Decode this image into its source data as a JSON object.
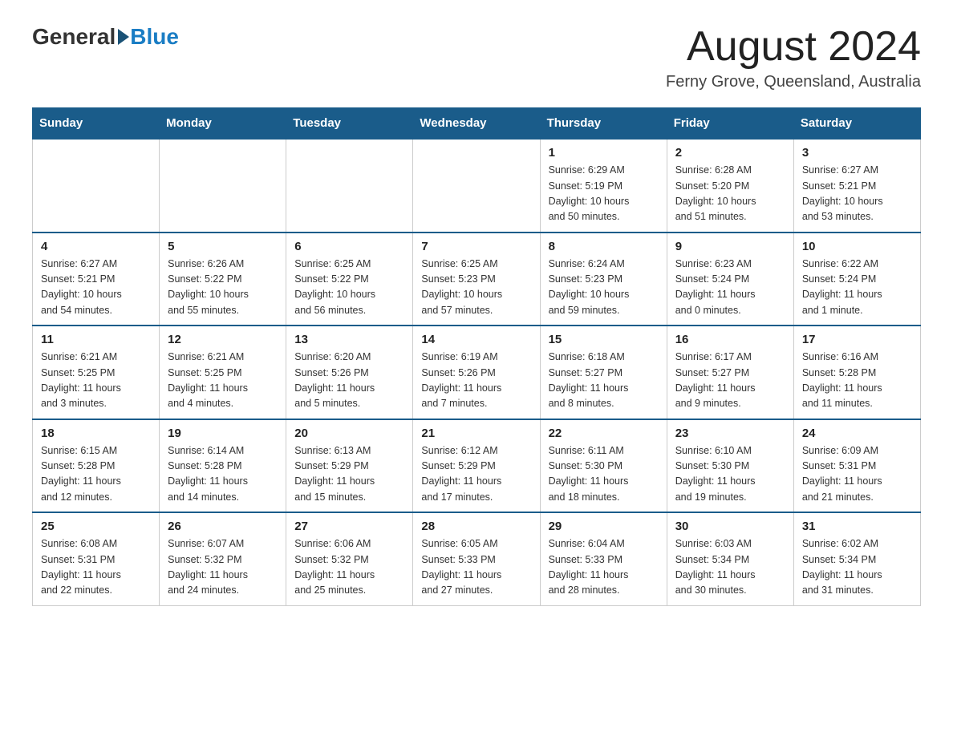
{
  "header": {
    "logo": {
      "general": "General",
      "blue": "Blue"
    },
    "title": "August 2024",
    "location": "Ferny Grove, Queensland, Australia"
  },
  "weekdays": [
    "Sunday",
    "Monday",
    "Tuesday",
    "Wednesday",
    "Thursday",
    "Friday",
    "Saturday"
  ],
  "weeks": [
    [
      {
        "day": "",
        "info": ""
      },
      {
        "day": "",
        "info": ""
      },
      {
        "day": "",
        "info": ""
      },
      {
        "day": "",
        "info": ""
      },
      {
        "day": "1",
        "info": "Sunrise: 6:29 AM\nSunset: 5:19 PM\nDaylight: 10 hours\nand 50 minutes."
      },
      {
        "day": "2",
        "info": "Sunrise: 6:28 AM\nSunset: 5:20 PM\nDaylight: 10 hours\nand 51 minutes."
      },
      {
        "day": "3",
        "info": "Sunrise: 6:27 AM\nSunset: 5:21 PM\nDaylight: 10 hours\nand 53 minutes."
      }
    ],
    [
      {
        "day": "4",
        "info": "Sunrise: 6:27 AM\nSunset: 5:21 PM\nDaylight: 10 hours\nand 54 minutes."
      },
      {
        "day": "5",
        "info": "Sunrise: 6:26 AM\nSunset: 5:22 PM\nDaylight: 10 hours\nand 55 minutes."
      },
      {
        "day": "6",
        "info": "Sunrise: 6:25 AM\nSunset: 5:22 PM\nDaylight: 10 hours\nand 56 minutes."
      },
      {
        "day": "7",
        "info": "Sunrise: 6:25 AM\nSunset: 5:23 PM\nDaylight: 10 hours\nand 57 minutes."
      },
      {
        "day": "8",
        "info": "Sunrise: 6:24 AM\nSunset: 5:23 PM\nDaylight: 10 hours\nand 59 minutes."
      },
      {
        "day": "9",
        "info": "Sunrise: 6:23 AM\nSunset: 5:24 PM\nDaylight: 11 hours\nand 0 minutes."
      },
      {
        "day": "10",
        "info": "Sunrise: 6:22 AM\nSunset: 5:24 PM\nDaylight: 11 hours\nand 1 minute."
      }
    ],
    [
      {
        "day": "11",
        "info": "Sunrise: 6:21 AM\nSunset: 5:25 PM\nDaylight: 11 hours\nand 3 minutes."
      },
      {
        "day": "12",
        "info": "Sunrise: 6:21 AM\nSunset: 5:25 PM\nDaylight: 11 hours\nand 4 minutes."
      },
      {
        "day": "13",
        "info": "Sunrise: 6:20 AM\nSunset: 5:26 PM\nDaylight: 11 hours\nand 5 minutes."
      },
      {
        "day": "14",
        "info": "Sunrise: 6:19 AM\nSunset: 5:26 PM\nDaylight: 11 hours\nand 7 minutes."
      },
      {
        "day": "15",
        "info": "Sunrise: 6:18 AM\nSunset: 5:27 PM\nDaylight: 11 hours\nand 8 minutes."
      },
      {
        "day": "16",
        "info": "Sunrise: 6:17 AM\nSunset: 5:27 PM\nDaylight: 11 hours\nand 9 minutes."
      },
      {
        "day": "17",
        "info": "Sunrise: 6:16 AM\nSunset: 5:28 PM\nDaylight: 11 hours\nand 11 minutes."
      }
    ],
    [
      {
        "day": "18",
        "info": "Sunrise: 6:15 AM\nSunset: 5:28 PM\nDaylight: 11 hours\nand 12 minutes."
      },
      {
        "day": "19",
        "info": "Sunrise: 6:14 AM\nSunset: 5:28 PM\nDaylight: 11 hours\nand 14 minutes."
      },
      {
        "day": "20",
        "info": "Sunrise: 6:13 AM\nSunset: 5:29 PM\nDaylight: 11 hours\nand 15 minutes."
      },
      {
        "day": "21",
        "info": "Sunrise: 6:12 AM\nSunset: 5:29 PM\nDaylight: 11 hours\nand 17 minutes."
      },
      {
        "day": "22",
        "info": "Sunrise: 6:11 AM\nSunset: 5:30 PM\nDaylight: 11 hours\nand 18 minutes."
      },
      {
        "day": "23",
        "info": "Sunrise: 6:10 AM\nSunset: 5:30 PM\nDaylight: 11 hours\nand 19 minutes."
      },
      {
        "day": "24",
        "info": "Sunrise: 6:09 AM\nSunset: 5:31 PM\nDaylight: 11 hours\nand 21 minutes."
      }
    ],
    [
      {
        "day": "25",
        "info": "Sunrise: 6:08 AM\nSunset: 5:31 PM\nDaylight: 11 hours\nand 22 minutes."
      },
      {
        "day": "26",
        "info": "Sunrise: 6:07 AM\nSunset: 5:32 PM\nDaylight: 11 hours\nand 24 minutes."
      },
      {
        "day": "27",
        "info": "Sunrise: 6:06 AM\nSunset: 5:32 PM\nDaylight: 11 hours\nand 25 minutes."
      },
      {
        "day": "28",
        "info": "Sunrise: 6:05 AM\nSunset: 5:33 PM\nDaylight: 11 hours\nand 27 minutes."
      },
      {
        "day": "29",
        "info": "Sunrise: 6:04 AM\nSunset: 5:33 PM\nDaylight: 11 hours\nand 28 minutes."
      },
      {
        "day": "30",
        "info": "Sunrise: 6:03 AM\nSunset: 5:34 PM\nDaylight: 11 hours\nand 30 minutes."
      },
      {
        "day": "31",
        "info": "Sunrise: 6:02 AM\nSunset: 5:34 PM\nDaylight: 11 hours\nand 31 minutes."
      }
    ]
  ]
}
